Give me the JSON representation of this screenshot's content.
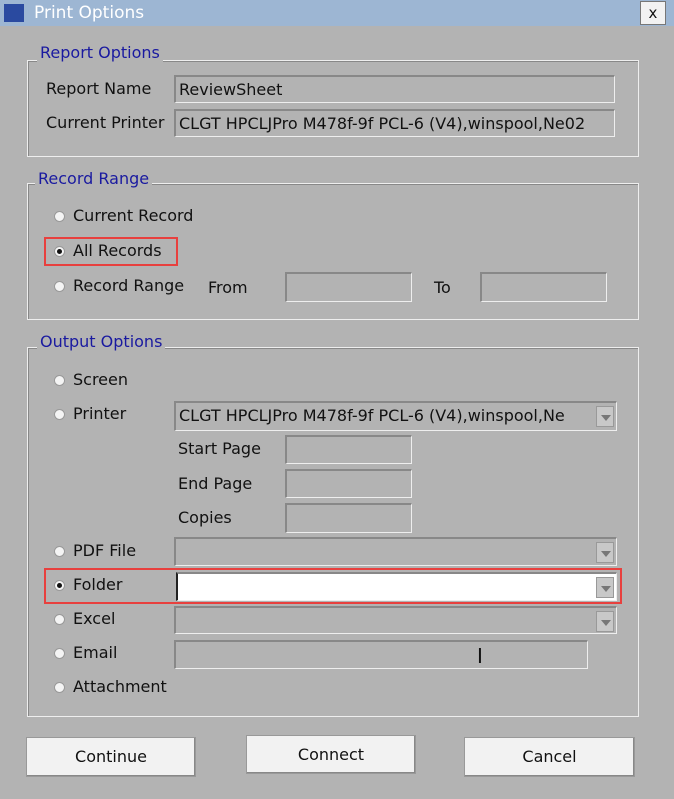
{
  "window": {
    "title": "Print Options",
    "close_label": "x"
  },
  "report_options": {
    "legend": "Report Options",
    "report_name_label": "Report Name",
    "report_name_value": "ReviewSheet",
    "current_printer_label": "Current Printer",
    "current_printer_value": "CLGT HPCLJPro  M478f-9f PCL-6 (V4),winspool,Ne02"
  },
  "record_range": {
    "legend": "Record Range",
    "options": [
      "Current Record",
      "All Records",
      "Record Range"
    ],
    "selected": "All Records",
    "from_label": "From",
    "from_value": "",
    "to_label": "To",
    "to_value": ""
  },
  "output_options": {
    "legend": "Output Options",
    "screen_label": "Screen",
    "printer_label": "Printer",
    "printer_value": "CLGT HPCLJPro  M478f-9f PCL-6 (V4),winspool,Ne",
    "start_page_label": "Start Page",
    "end_page_label": "End Page",
    "copies_label": "Copies",
    "pdf_label": "PDF File",
    "folder_label": "Folder",
    "folder_value": "",
    "excel_label": "Excel",
    "email_label": "Email",
    "attachment_label": "Attachment",
    "selected": "Folder"
  },
  "buttons": {
    "continue": "Continue",
    "connect": "Connect",
    "cancel": "Cancel"
  },
  "colors": {
    "highlight": "#e8403e",
    "legend": "#1a1aa0",
    "titlebar": "#9db6d3"
  }
}
